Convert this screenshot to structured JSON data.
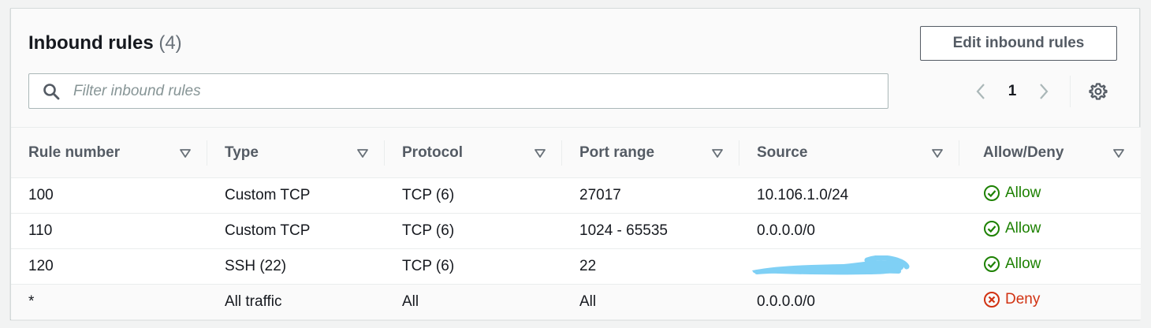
{
  "header": {
    "title": "Inbound rules",
    "count": "(4)",
    "edit_button": "Edit inbound rules"
  },
  "search": {
    "placeholder": "Filter inbound rules"
  },
  "pagination": {
    "current_page": "1"
  },
  "table": {
    "columns": [
      "Rule number",
      "Type",
      "Protocol",
      "Port range",
      "Source",
      "Allow/Deny"
    ],
    "rows": [
      {
        "rule_number": "100",
        "type": "Custom TCP",
        "protocol": "TCP (6)",
        "port_range": "27017",
        "source": "10.106.1.0/24",
        "action": "Allow"
      },
      {
        "rule_number": "110",
        "type": "Custom TCP",
        "protocol": "TCP (6)",
        "port_range": "1024 - 65535",
        "source": "0.0.0.0/0",
        "action": "Allow"
      },
      {
        "rule_number": "120",
        "type": "SSH (22)",
        "protocol": "TCP (6)",
        "port_range": "22",
        "source": "",
        "action": "Allow"
      },
      {
        "rule_number": "*",
        "type": "All traffic",
        "protocol": "All",
        "port_range": "All",
        "source": "0.0.0.0/0",
        "action": "Deny"
      }
    ]
  },
  "colors": {
    "allow": "#1d8102",
    "deny": "#d13212",
    "redaction": "#7fd0f5",
    "button_border": "#545b64"
  },
  "icons": {
    "search": "search-icon",
    "prev": "chevron-left-icon",
    "next": "chevron-right-icon",
    "settings": "gear-icon",
    "sort": "sort-caret-icon",
    "allow": "check-circle-icon",
    "deny": "x-circle-icon"
  }
}
